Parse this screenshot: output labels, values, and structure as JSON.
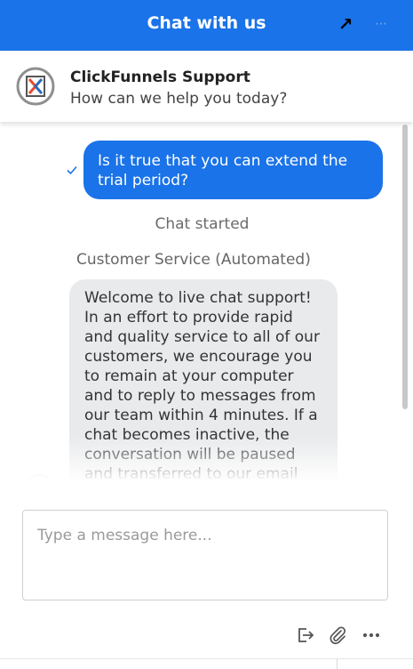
{
  "window": {
    "title": "Chat with us"
  },
  "agent": {
    "name": "ClickFunnels Support",
    "tagline": "How can we help you today?"
  },
  "messages": {
    "user_text": "Is it true that you can extend the trial period?",
    "status_note": "Chat started",
    "agent_label": "Customer Service (Automated)",
    "agent_text": "Welcome to live chat support! In an effort to provide rapid and quality service to all of our customers, we encourage you to remain at your computer and to reply to messages from our team within 4 minutes. If a chat becomes inactive, the conversation will be paused and transferred to our email"
  },
  "composer": {
    "placeholder": "Type a message here..."
  },
  "icons": {
    "expand": "arrow-up-right-icon",
    "menu": "more-horizontal-icon",
    "check": "check-icon",
    "logo": "clickfunnels-logo",
    "end_chat": "exit-icon",
    "attach": "paperclip-icon",
    "more": "ellipsis-icon"
  },
  "colors": {
    "brand": "#1a73e8",
    "agent_bubble": "#e9eaec"
  }
}
